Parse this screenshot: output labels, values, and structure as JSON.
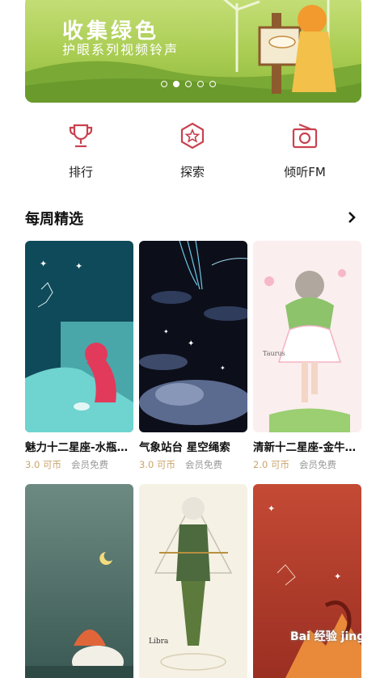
{
  "banner": {
    "title": "收集绿色",
    "subtitle": "护眼系列视频铃声",
    "dots": 5,
    "active_dot": 1
  },
  "quick_nav": [
    {
      "label": "排行",
      "icon": "trophy-icon"
    },
    {
      "label": "探索",
      "icon": "star-badge-icon"
    },
    {
      "label": "倾听FM",
      "icon": "radio-icon"
    }
  ],
  "section": {
    "title": "每周精选",
    "more_icon": "chevron-right-icon"
  },
  "cards": [
    {
      "title": "魅力十二星座-水瓶…",
      "price": "3.0 可币",
      "vip": "会员免费"
    },
    {
      "title": "气象站台 星空绳索",
      "price": "3.0 可币",
      "vip": "会员免费"
    },
    {
      "title": "清新十二星座-金牛…",
      "price": "2.0 可币",
      "vip": "会员免费"
    },
    {
      "title": "",
      "price": "",
      "vip": ""
    },
    {
      "title": "",
      "price": "",
      "vip": ""
    },
    {
      "title": "",
      "price": "",
      "vip": ""
    }
  ],
  "artwork_text": {
    "taurus": "Taurus",
    "libra": "Libra"
  },
  "watermark": "Bai 经验 jingyan.baidu.com",
  "colors": {
    "accent": "#c8424f",
    "price": "#c9a46b"
  }
}
